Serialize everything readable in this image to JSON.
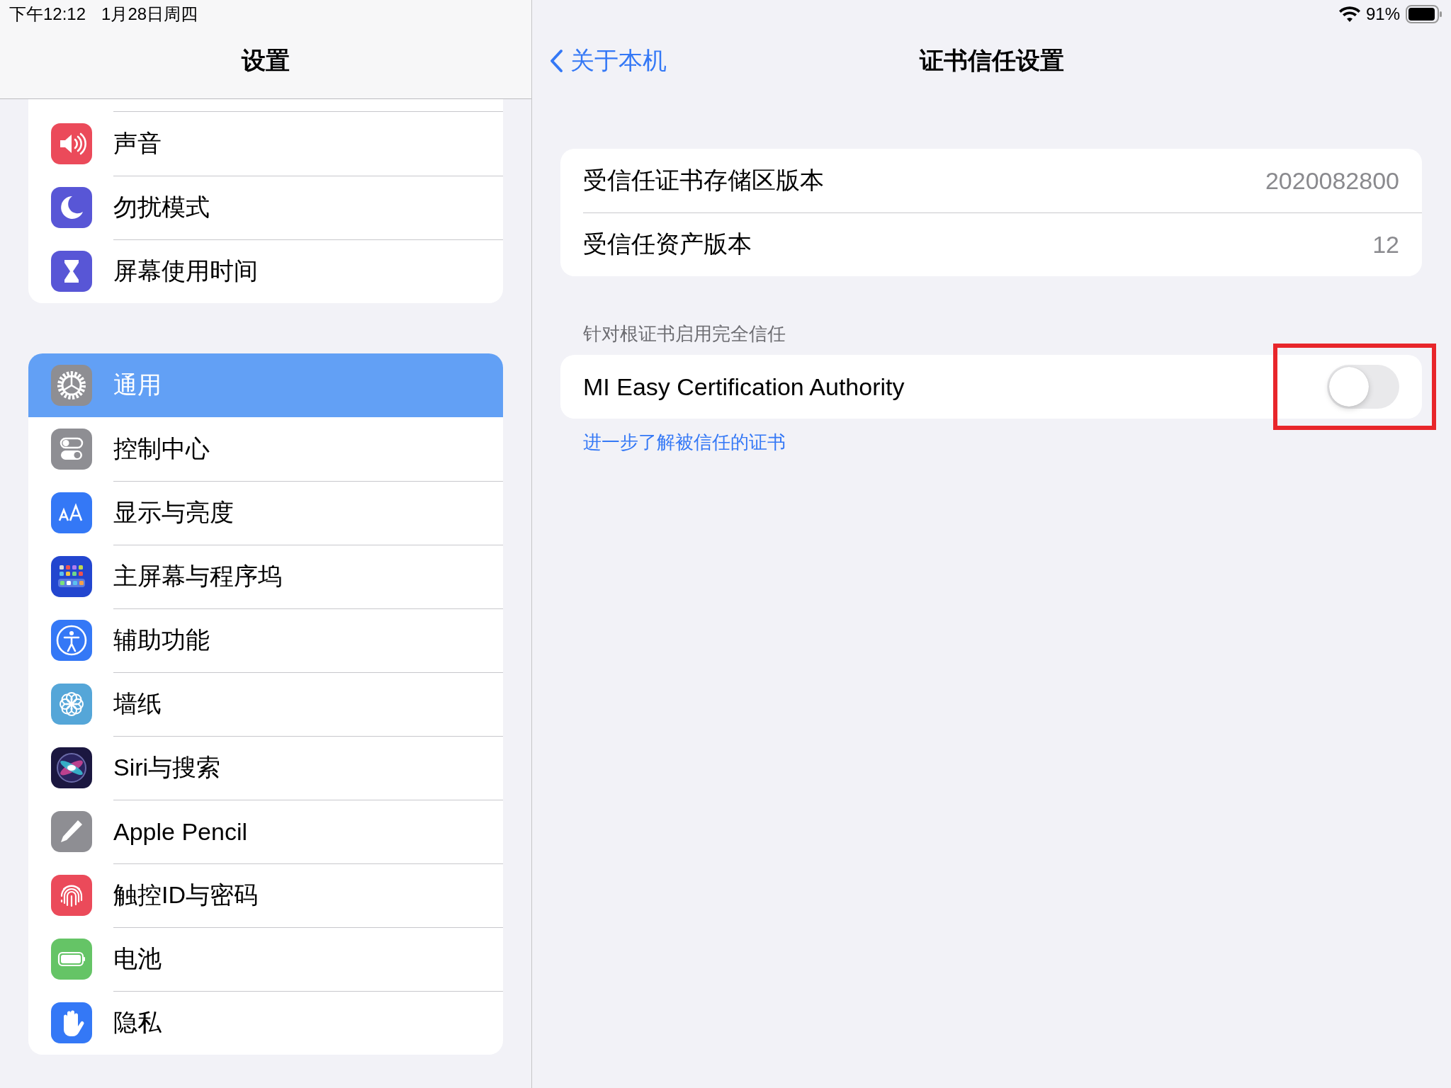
{
  "status_bar": {
    "time": "下午12:12",
    "date": "1月28日周四",
    "battery_percent": "91%"
  },
  "sidebar": {
    "title": "设置",
    "groups": [
      {
        "items": [
          {
            "label": "声音",
            "kind": "sound",
            "selected": false
          },
          {
            "label": "勿扰模式",
            "kind": "do_not_disturb",
            "selected": false
          },
          {
            "label": "屏幕使用时间",
            "kind": "screen_time",
            "selected": false
          }
        ]
      },
      {
        "items": [
          {
            "label": "通用",
            "kind": "general",
            "selected": true
          },
          {
            "label": "控制中心",
            "kind": "control_center",
            "selected": false
          },
          {
            "label": "显示与亮度",
            "kind": "display",
            "selected": false
          },
          {
            "label": "主屏幕与程序坞",
            "kind": "home_screen",
            "selected": false
          },
          {
            "label": "辅助功能",
            "kind": "accessibility",
            "selected": false
          },
          {
            "label": "墙纸",
            "kind": "wallpaper",
            "selected": false
          },
          {
            "label": "Siri与搜索",
            "kind": "siri",
            "selected": false
          },
          {
            "label": "Apple Pencil",
            "kind": "pencil",
            "selected": false
          },
          {
            "label": "触控ID与密码",
            "kind": "touch_id",
            "selected": false
          },
          {
            "label": "电池",
            "kind": "battery",
            "selected": false
          },
          {
            "label": "隐私",
            "kind": "privacy",
            "selected": false
          }
        ]
      }
    ]
  },
  "detail": {
    "back_label": "关于本机",
    "title": "证书信任设置",
    "info_rows": [
      {
        "label": "受信任证书存储区版本",
        "value": "2020082800"
      },
      {
        "label": "受信任资产版本",
        "value": "12"
      }
    ],
    "trust_section": {
      "header": "针对根证书启用完全信任",
      "items": [
        {
          "label": "MI Easy Certification Authority",
          "on": false,
          "highlighted": true
        }
      ],
      "footer_link": "进一步了解被信任的证书"
    }
  }
}
